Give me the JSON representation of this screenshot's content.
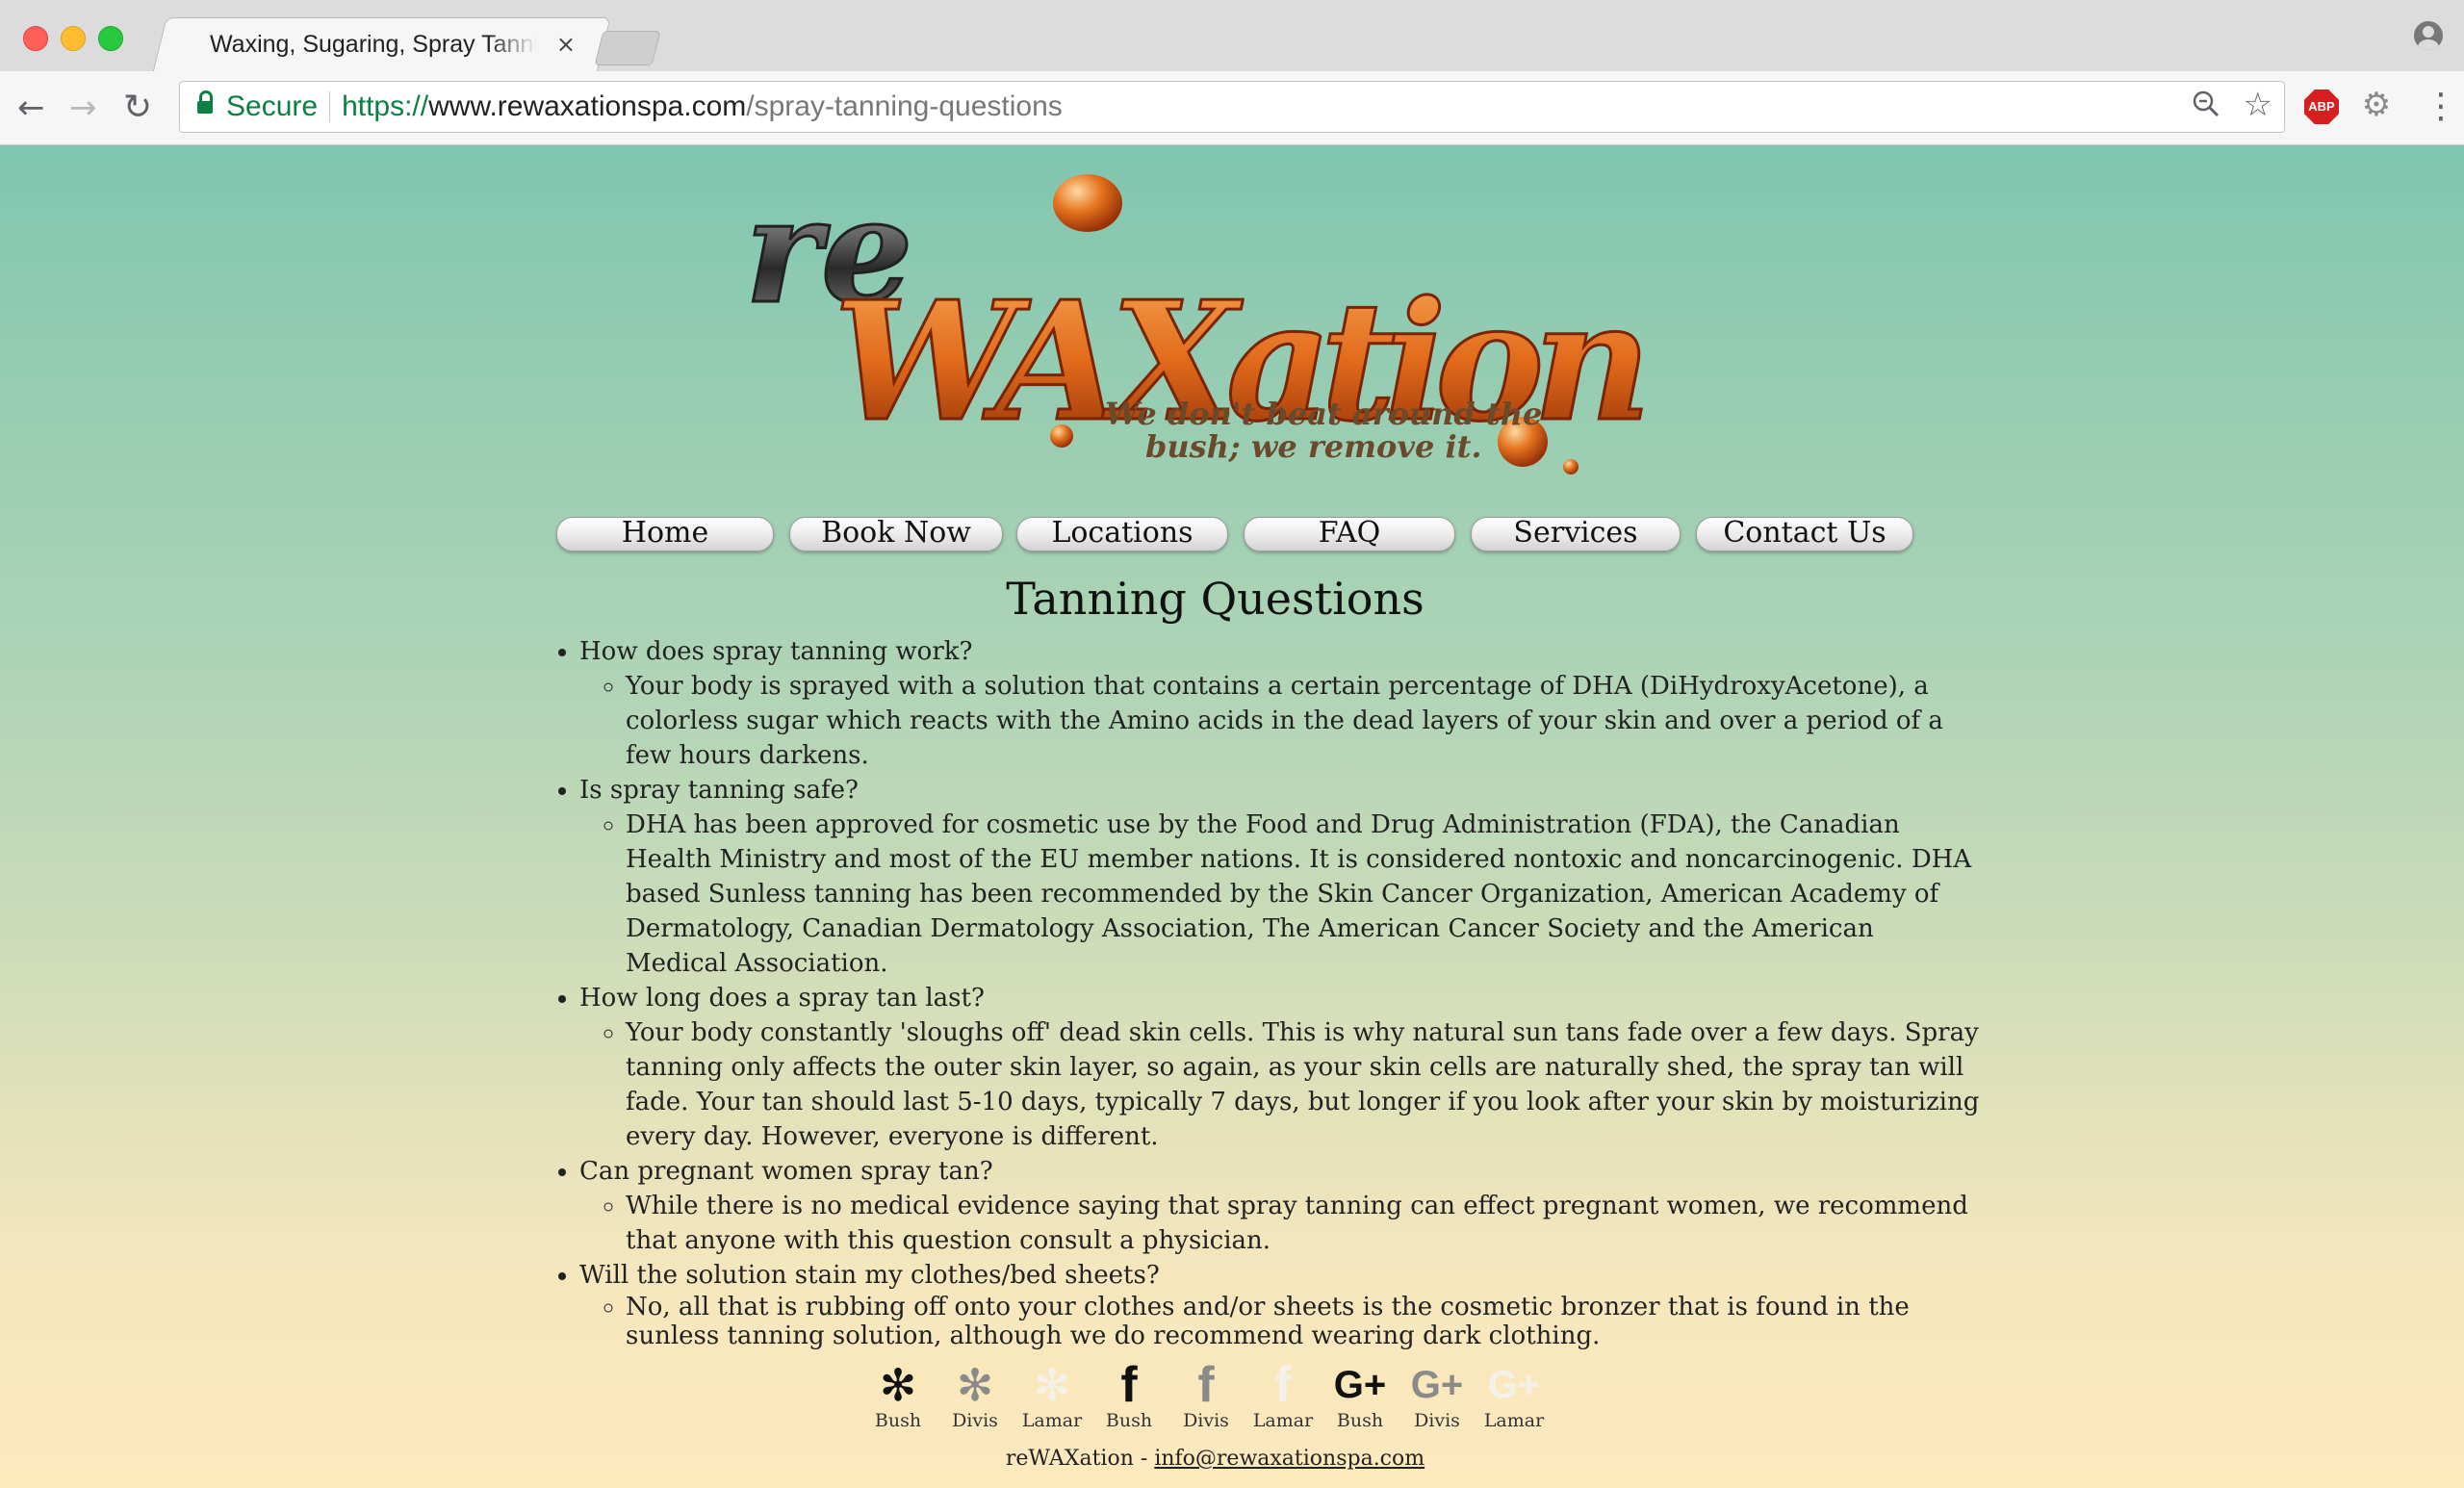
{
  "browser": {
    "tab_title": "Waxing, Sugaring, Spray Tanning",
    "tab_close": "×",
    "secure_label": "Secure",
    "url_scheme": "https://",
    "url_host": "www.rewaxationspa.com",
    "url_path": "/spray-tanning-questions",
    "extension_abp": "ABP",
    "icons": [
      "back-arrow-icon",
      "forward-arrow-icon",
      "reload-icon",
      "lock-icon",
      "zoom-icon",
      "star-icon",
      "adblock-icon",
      "gear-icon",
      "menu-icon",
      "profile-icon"
    ]
  },
  "logo": {
    "re": "re",
    "wax": "WAXation",
    "tagline_line1": "We don't beat around the",
    "tagline_line2": "bush; we remove it."
  },
  "nav": {
    "items": [
      {
        "label": "Home"
      },
      {
        "label": "Book Now"
      },
      {
        "label": "Locations"
      },
      {
        "label": "FAQ"
      },
      {
        "label": "Services"
      },
      {
        "label": "Contact Us"
      }
    ]
  },
  "page": {
    "title": "Tanning Questions",
    "faq": [
      {
        "question": "How does spray tanning work?",
        "answer": "Your body is sprayed with a solution that contains a certain percentage of DHA (DiHydroxyAcetone), a colorless sugar which reacts with the Amino acids in the dead layers of your skin and over a period of a few hours darkens."
      },
      {
        "question": "Is spray tanning safe?",
        "answer": "DHA has been approved for cosmetic use by the Food and Drug Administration (FDA), the Canadian Health Ministry and most of the EU member nations. It is considered nontoxic and noncarcinogenic. DHA based Sunless tanning has been recommended by the Skin Cancer Organization, American Academy of Dermatology, Canadian Dermatology Association, The American Cancer Society and the American Medical Association."
      },
      {
        "question": "How long does a spray tan last?",
        "answer": "Your body constantly 'sloughs off' dead skin cells. This is why natural sun tans fade over a few days. Spray tanning only affects the outer skin layer, so again, as your skin cells are naturally shed, the spray tan will fade. Your tan should last 5-10 days, typically 7 days, but longer if you look after your skin by moisturizing every day. However, everyone is different."
      },
      {
        "question": "Can pregnant women spray tan?",
        "answer": "While there is no medical evidence saying that spray tanning can effect pregnant women, we recommend that anyone with this question consult a physician."
      },
      {
        "question": "Will the solution stain my clothes/bed sheets?",
        "answer": "No, all that is rubbing off onto your clothes and/or sheets is the cosmetic bronzer that is found in the sunless tanning solution, although we do recommend wearing dark clothing."
      }
    ]
  },
  "social": {
    "items": [
      {
        "icon": "yelp-icon",
        "glyph": "✻",
        "label": "Bush",
        "color": "#111111"
      },
      {
        "icon": "yelp-icon",
        "glyph": "✻",
        "label": "Divis",
        "color": "#8a8a8a"
      },
      {
        "icon": "yelp-icon",
        "glyph": "✻",
        "label": "Lamar",
        "color": "#f4f1ea"
      },
      {
        "icon": "facebook-icon",
        "glyph": "f",
        "label": "Bush",
        "color": "#111111"
      },
      {
        "icon": "facebook-icon",
        "glyph": "f",
        "label": "Divis",
        "color": "#8a8a8a"
      },
      {
        "icon": "facebook-icon",
        "glyph": "f",
        "label": "Lamar",
        "color": "#f4f1ea"
      },
      {
        "icon": "google-plus-icon",
        "glyph": "G+",
        "label": "Bush",
        "color": "#111111"
      },
      {
        "icon": "google-plus-icon",
        "glyph": "G+",
        "label": "Divis",
        "color": "#8a8a8a"
      },
      {
        "icon": "google-plus-icon",
        "glyph": "G+",
        "label": "Lamar",
        "color": "#f4f1ea"
      }
    ]
  },
  "footer": {
    "brand": "reWAXation - ",
    "email": "info@rewaxationspa.com"
  },
  "colors": {
    "gradient_top": "#80c6b0",
    "gradient_bottom": "#fee9bd",
    "wax_orange": "#e06a1a",
    "secure_green": "#0b8043"
  }
}
